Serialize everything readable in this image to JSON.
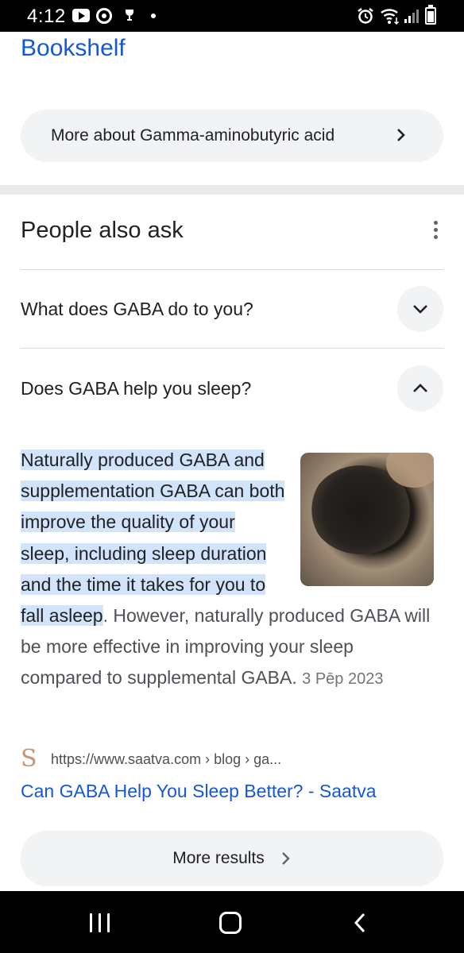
{
  "status_bar": {
    "time": "4:12",
    "left_icons": [
      "youtube-icon",
      "chrome-icon",
      "trophy-icon",
      "dot-icon"
    ],
    "right_icons": [
      "alarm-icon",
      "wifi-icon",
      "signal-icon",
      "battery-icon"
    ]
  },
  "top_link": {
    "label": "Bookshelf"
  },
  "more_about_button": {
    "label": "More about Gamma-aminobutyric acid"
  },
  "people_also_ask": {
    "title": "People also ask",
    "questions": [
      {
        "label": "What does GABA do to you?",
        "state": "collapsed"
      },
      {
        "label": "Does GABA help you sleep?",
        "state": "expanded"
      }
    ],
    "answer": {
      "highlighted": "Naturally produced GABA and supplementation GABA can both improve the quality of your sleep, including sleep duration and the time it takes for you to fall asleep",
      "rest": ". However, naturally produced GABA will be more effective in improving your sleep compared to supplemental GABA.",
      "date": "3 Pēp 2023",
      "image": "gaba-tea-leaves-in-burlap-sack"
    },
    "source": {
      "favicon_letter": "S",
      "url": "https://www.saatva.com › blog › ga...",
      "title": "Can GABA Help You Sleep Better? - Saatva"
    }
  },
  "more_results_button": {
    "label": "More results"
  },
  "nav_bar": {
    "buttons": [
      "recent-apps-icon",
      "home-icon",
      "back-icon"
    ]
  },
  "colors": {
    "link": "#1558d6",
    "highlight": "#d2e3fc",
    "pill_bg": "#f1f3f4",
    "divider": "#dadce0",
    "text": "#202124",
    "secondary_text": "#4d5156"
  }
}
